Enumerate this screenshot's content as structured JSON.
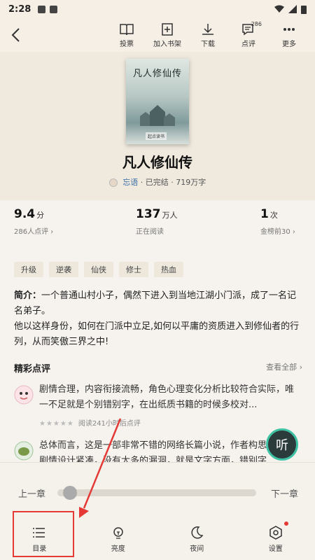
{
  "status_bar": {
    "time": "2:28"
  },
  "top_bar": {
    "actions": [
      {
        "label": "投票",
        "icon": "book-icon"
      },
      {
        "label": "加入书架",
        "icon": "add-bookshelf-icon"
      },
      {
        "label": "下载",
        "icon": "download-icon"
      },
      {
        "label": "点评",
        "icon": "comment-icon",
        "badge": "286"
      },
      {
        "label": "更多",
        "icon": "more-icon"
      }
    ]
  },
  "book": {
    "cover_title": "凡人修仙传",
    "cover_logo": "起点读书",
    "title": "凡人修仙传",
    "author": "忘语",
    "status": "· 已完结 · 719万字"
  },
  "stats": [
    {
      "value": "9.4",
      "unit": "分",
      "sub": "286人点评 ›"
    },
    {
      "value": "137",
      "unit": "万人",
      "sub": "正在阅读"
    },
    {
      "value": "1",
      "unit": "次",
      "sub": "金榜前30 ›"
    }
  ],
  "tags": [
    "升级",
    "逆袭",
    "仙侠",
    "修士",
    "热血"
  ],
  "intro": {
    "label": "简介：",
    "text1": "一个普通山村小子，偶然下进入到当地江湖小门派，成了一名记名弟子。",
    "text2": "他以这样身份，如何在门派中立足,如何以平庸的资质进入到修仙者的行列，从而笑傲三界之中!"
  },
  "reviews": {
    "title": "精彩点评",
    "more": "查看全部 ›",
    "items": [
      {
        "text": "剧情合理，内容衔接流畅，角色心理变化分析比较符合实际，唯一不足就是个别错别字，在出纸质书籍的时候多校对...",
        "stars": "★★★★★",
        "meta": "阅读241小时后点评"
      },
      {
        "text": "总体而言，这是一部非常不错的网络长篇小说，作者构思巧妙，剧情设计紧凑，没有太多的漏洞，就是文字方面，错别字"
      }
    ]
  },
  "listen_button": "听",
  "reader_overlay": {
    "prev": "上一章",
    "next": "下一章",
    "progress": 0.03,
    "nav": [
      {
        "label": "目录",
        "icon": "list-icon"
      },
      {
        "label": "亮度",
        "icon": "brightness-icon"
      },
      {
        "label": "夜间",
        "icon": "moon-icon"
      },
      {
        "label": "设置",
        "icon": "settings-icon"
      }
    ]
  },
  "colors": {
    "highlight": "#e53935",
    "accent": "#3ec2a3",
    "author_link": "#3a6ea5"
  }
}
